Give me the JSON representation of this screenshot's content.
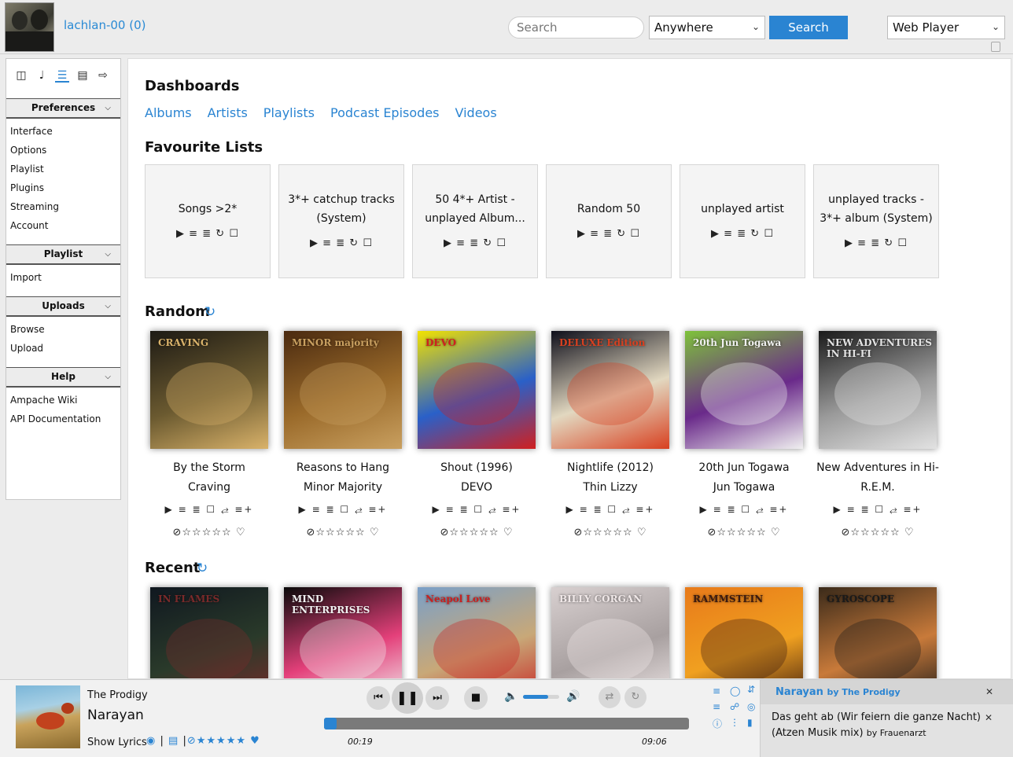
{
  "header": {
    "username": "lachlan-00 (0)",
    "search_placeholder": "Search",
    "scope_selected": "Anywhere",
    "search_button": "Search",
    "player_selected": "Web Player"
  },
  "sidebar": {
    "tabs": [
      "headphones-icon",
      "speaker-icon",
      "preferences-icon",
      "admin-icon",
      "logout-icon"
    ],
    "sections": [
      {
        "title": "Preferences",
        "items": [
          "Interface",
          "Options",
          "Playlist",
          "Plugins",
          "Streaming",
          "Account"
        ]
      },
      {
        "title": "Playlist",
        "items": [
          "Import"
        ]
      },
      {
        "title": "Uploads",
        "items": [
          "Browse",
          "Upload"
        ]
      },
      {
        "title": "Help",
        "items": [
          "Ampache Wiki",
          "API Documentation"
        ]
      }
    ]
  },
  "main": {
    "dashboards_title": "Dashboards",
    "dashboard_links": [
      "Albums",
      "Artists",
      "Playlists",
      "Podcast Episodes",
      "Videos"
    ],
    "favourites_title": "Favourite Lists",
    "favourites": [
      {
        "line1": "Songs >2*",
        "line2": ""
      },
      {
        "line1": "3*+ catchup tracks",
        "line2": "(System)"
      },
      {
        "line1": "50 4*+ Artist -",
        "line2": "unplayed Album..."
      },
      {
        "line1": "Random 50",
        "line2": ""
      },
      {
        "line1": "unplayed artist",
        "line2": ""
      },
      {
        "line1": "unplayed tracks -",
        "line2": "3*+ album (System)"
      }
    ],
    "random_title": "Random",
    "random_albums": [
      {
        "name": "By the Storm",
        "artist": "Craving",
        "cover_text": "CRAVING",
        "colors": [
          "#1d1a14",
          "#6b5a30",
          "#d9b26a"
        ]
      },
      {
        "name": "Reasons to Hang",
        "artist": "Minor Majority",
        "cover_text": "MINOR majority",
        "colors": [
          "#4a2a10",
          "#9a6a2a",
          "#c9a060"
        ]
      },
      {
        "name": "Shout (1996)",
        "artist": "DEVO",
        "cover_text": "DEVO",
        "colors": [
          "#f2e200",
          "#2a60c8",
          "#d02020"
        ]
      },
      {
        "name": "Nightlife (2012)",
        "artist": "Thin Lizzy",
        "cover_text": "DELUXE Edition",
        "colors": [
          "#0e0e1a",
          "#e2d8c0",
          "#d84020"
        ]
      },
      {
        "name": "20th Jun Togawa",
        "artist": "Jun Togawa",
        "cover_text": "20th Jun Togawa",
        "colors": [
          "#7ec23a",
          "#6a2a8a",
          "#f0f0f0"
        ]
      },
      {
        "name": "New Adventures in Hi-",
        "artist": "R.E.M.",
        "cover_text": "NEW ADVENTURES IN HI-FI",
        "colors": [
          "#1a1a1a",
          "#9a9a9a",
          "#e2e2e2"
        ]
      }
    ],
    "recent_title": "Recent",
    "recent_albums": [
      {
        "cover_text": "IN FLAMES",
        "colors": [
          "#101820",
          "#2a3a2a",
          "#7a2a2a"
        ]
      },
      {
        "cover_text": "MIND ENTERPRISES",
        "colors": [
          "#0a0a0a",
          "#e4407a",
          "#f0f0f0"
        ]
      },
      {
        "cover_text": "Neapol Love",
        "colors": [
          "#7aa0c8",
          "#c8a878",
          "#c82020"
        ]
      },
      {
        "cover_text": "BILLY CORGAN",
        "colors": [
          "#d8d0d0",
          "#a8a0a0",
          "#f0e8e8"
        ]
      },
      {
        "cover_text": "RAMMSTEIN",
        "colors": [
          "#e87a1a",
          "#f0a020",
          "#3a1a10"
        ]
      },
      {
        "cover_text": "GYROSCOPE",
        "colors": [
          "#3a2a1a",
          "#c87a3a",
          "#1a1a1a"
        ]
      }
    ]
  },
  "player": {
    "artist": "The Prodigy",
    "title": "Narayan",
    "show_lyrics": "Show Lyrics",
    "time_current": "00:19",
    "time_total": "09:06",
    "progress_fraction": 0.035,
    "volume_fraction": 0.7,
    "playlist": {
      "current_title": "Narayan",
      "current_by": "by The Prodigy",
      "next_title": "Das geht ab (Wir feiern die ganze Nacht) (Atzen Musik mix)",
      "next_by": "by Frauenarzt"
    }
  }
}
